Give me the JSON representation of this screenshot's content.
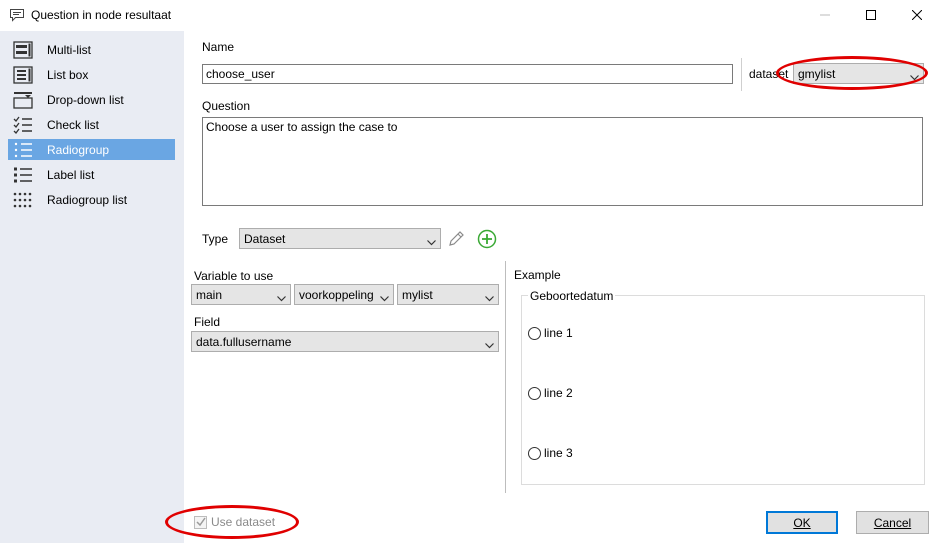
{
  "window": {
    "title": "Question in node resultaat"
  },
  "sidebar": {
    "items": [
      {
        "label": "Multi-list",
        "icon": "multi-list-icon"
      },
      {
        "label": "List box",
        "icon": "list-box-icon"
      },
      {
        "label": "Drop-down list",
        "icon": "dropdown-list-icon"
      },
      {
        "label": "Check list",
        "icon": "check-list-icon"
      },
      {
        "label": "Radiogroup",
        "icon": "radiogroup-icon",
        "selected": true
      },
      {
        "label": "Label list",
        "icon": "label-list-icon"
      },
      {
        "label": "Radiogroup list",
        "icon": "radiogroup-list-icon"
      }
    ]
  },
  "form": {
    "name_label": "Name",
    "name_value": "choose_user",
    "dataset_label": "dataset",
    "dataset_value": "gmylist",
    "question_label": "Question",
    "question_value": "Choose a user to assign the case to",
    "type_label": "Type",
    "type_value": "Dataset",
    "variable_label": "Variable to use",
    "variable_values": [
      "main",
      "voorkoppeling",
      "mylist"
    ],
    "field_label": "Field",
    "field_value": "data.fullusername"
  },
  "example": {
    "label": "Example",
    "group_title": "Geboortedatum",
    "options": [
      "line 1",
      "line 2",
      "line 3"
    ]
  },
  "footer": {
    "use_dataset_label": "Use dataset",
    "use_dataset_checked": true,
    "ok_label": "OK",
    "cancel_label": "Cancel"
  },
  "colors": {
    "selection": "#6aa6e3",
    "sidebar_bg": "#e9ecf3",
    "highlight_oval": "#e00000",
    "default_button_border": "#0078d7",
    "add_icon": "#3aa935"
  }
}
